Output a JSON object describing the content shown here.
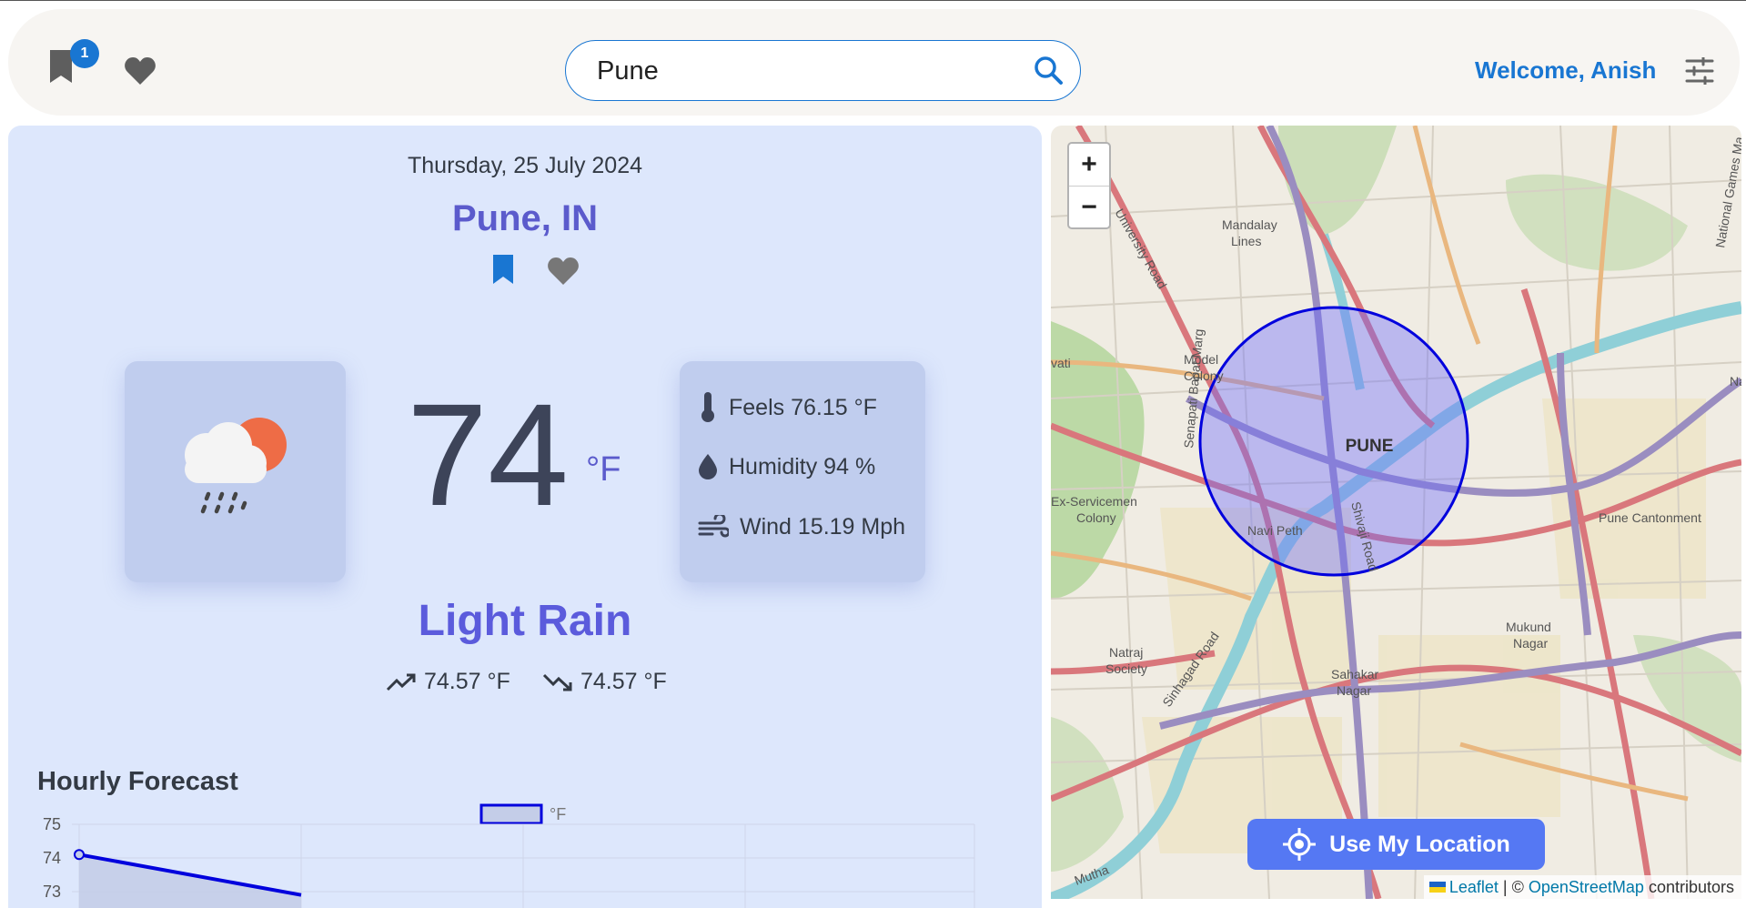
{
  "header": {
    "bookmark_badge": "1",
    "search": {
      "value": "Pune"
    },
    "welcome": "Welcome, Anish"
  },
  "weather": {
    "date": "Thursday, 25 July 2024",
    "city": "Pune, IN",
    "temp": "74",
    "unit": "°F",
    "feels": "Feels 76.15 °F",
    "humidity": "Humidity 94 %",
    "wind": "Wind 15.19 Mph",
    "condition": "Light Rain",
    "high": "74.57 °F",
    "low": "74.57 °F"
  },
  "hourly": {
    "title": "Hourly Forecast"
  },
  "chart_data": {
    "type": "line",
    "legend": "°F",
    "y_ticks": [
      "75",
      "74",
      "73"
    ],
    "ylim": [
      73,
      75
    ],
    "series": [
      {
        "name": "°F",
        "values": [
          74.1,
          72.9
        ]
      }
    ]
  },
  "map": {
    "zoom_in": "+",
    "zoom_out": "−",
    "city_label": "PUNE",
    "labels": {
      "mandalay": "Mandalay",
      "lines": "Lines",
      "university_road": "University Road",
      "senapati": "Senapati Bapat Marg",
      "model_colony_1": "Model",
      "model_colony_2": "Colony",
      "ex_servicemen_1": "Ex-Servicemen",
      "ex_servicemen_2": "Colony",
      "navi_peth": "Navi Peth",
      "shivaji_road": "Shivaji Road",
      "pune_cantonment": "Pune Cantonment",
      "mukund_1": "Mukund",
      "mukund_2": "Nagar",
      "natraj_1": "Natraj",
      "natraj_2": "Society",
      "sahakar_1": "Sahakar",
      "sahakar_2": "Nagar",
      "sinhagad": "Sinhagad Road",
      "national_games": "National Games Ma",
      "mutha": "Mutha",
      "vati": "vati",
      "nagar_edge": "Nagar"
    },
    "use_location": "Use My Location",
    "attribution": {
      "leaflet": "Leaflet",
      "sep": " | © ",
      "osm": "OpenStreetMap",
      "contributors": " contributors"
    }
  },
  "colors": {
    "accent": "#1976d2",
    "city": "#5b5bcc",
    "card_bg": "#dde7fc",
    "circle": "#0000dd"
  }
}
